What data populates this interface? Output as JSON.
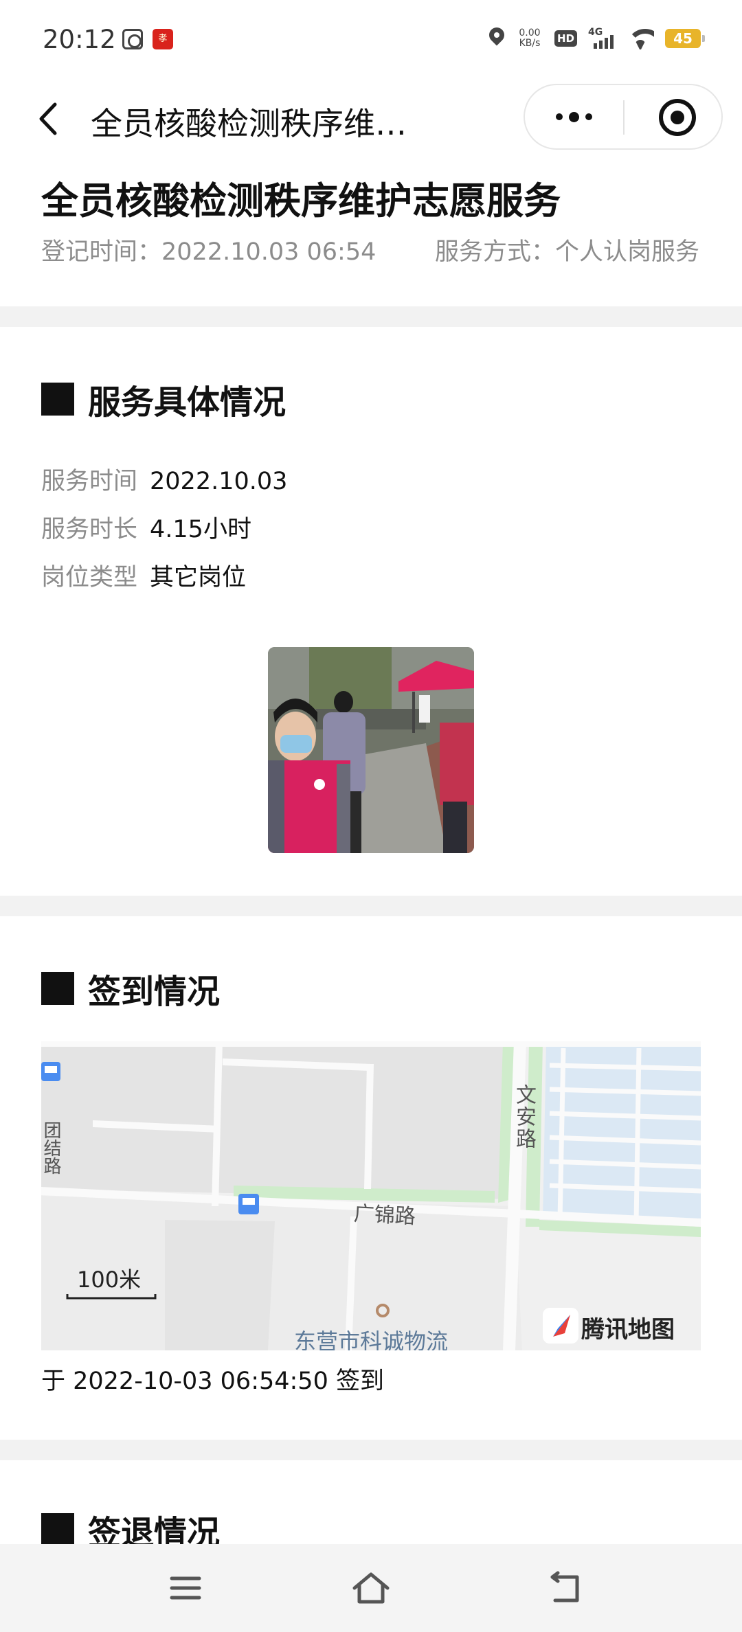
{
  "status_bar": {
    "time": "20:12",
    "app_icon_2": "孝",
    "speed_value": "0.00",
    "speed_unit": "KB/s",
    "hd_label": "HD",
    "network": "4G",
    "battery": "45",
    "battery_color": "#e8b42a"
  },
  "nav": {
    "title": "全员核酸检测秩序维…",
    "more_icon": "more-dots-icon",
    "close_icon": "target-close-icon"
  },
  "header": {
    "title": "全员核酸检测秩序维护志愿服务",
    "register_time": "登记时间：2022.10.03 06:54",
    "service_mode": "服务方式：个人认岗服务"
  },
  "service_detail": {
    "section_title": "服务具体情况",
    "rows": [
      {
        "label": "服务时间",
        "value": "2022.10.03"
      },
      {
        "label": "服务时长",
        "value": "4.15小时"
      },
      {
        "label": "岗位类型",
        "value": "其它岗位"
      }
    ]
  },
  "signin": {
    "section_title": "签到情况",
    "map": {
      "road_1": "文安路",
      "road_2": "广锦路",
      "road_3": "团结路",
      "poi": "东营市科诚物流",
      "scale": "100米",
      "provider": "腾讯地图"
    },
    "text": "于 2022-10-03 06:54:50 签到"
  },
  "signout": {
    "section_title": "签退情况"
  },
  "bottom_nav": {
    "menu_icon": "menu-icon",
    "home_icon": "home-icon",
    "back_icon": "back-icon"
  }
}
